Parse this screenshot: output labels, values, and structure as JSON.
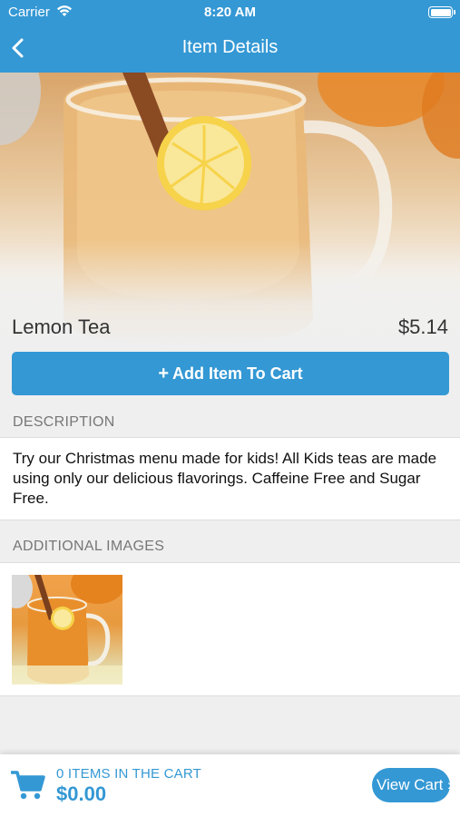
{
  "status_bar": {
    "carrier": "Carrier",
    "time": "8:20 AM"
  },
  "navbar": {
    "title": "Item Details"
  },
  "item": {
    "name": "Lemon Tea",
    "price": "$5.14"
  },
  "actions": {
    "add_to_cart": "Add Item To Cart"
  },
  "description": {
    "header": "DESCRIPTION",
    "text": "Try our Christmas menu made for kids!  All Kids teas are made using only our delicious flavorings.  Caffeine Free and Sugar Free."
  },
  "additional_images": {
    "header": "ADDITIONAL IMAGES"
  },
  "cart": {
    "count_label": "0 ITEMS IN THE CART",
    "total": "$0.00",
    "view_cart": "View Cart ›"
  },
  "colors": {
    "accent": "#3498d4",
    "background": "#efefef"
  }
}
